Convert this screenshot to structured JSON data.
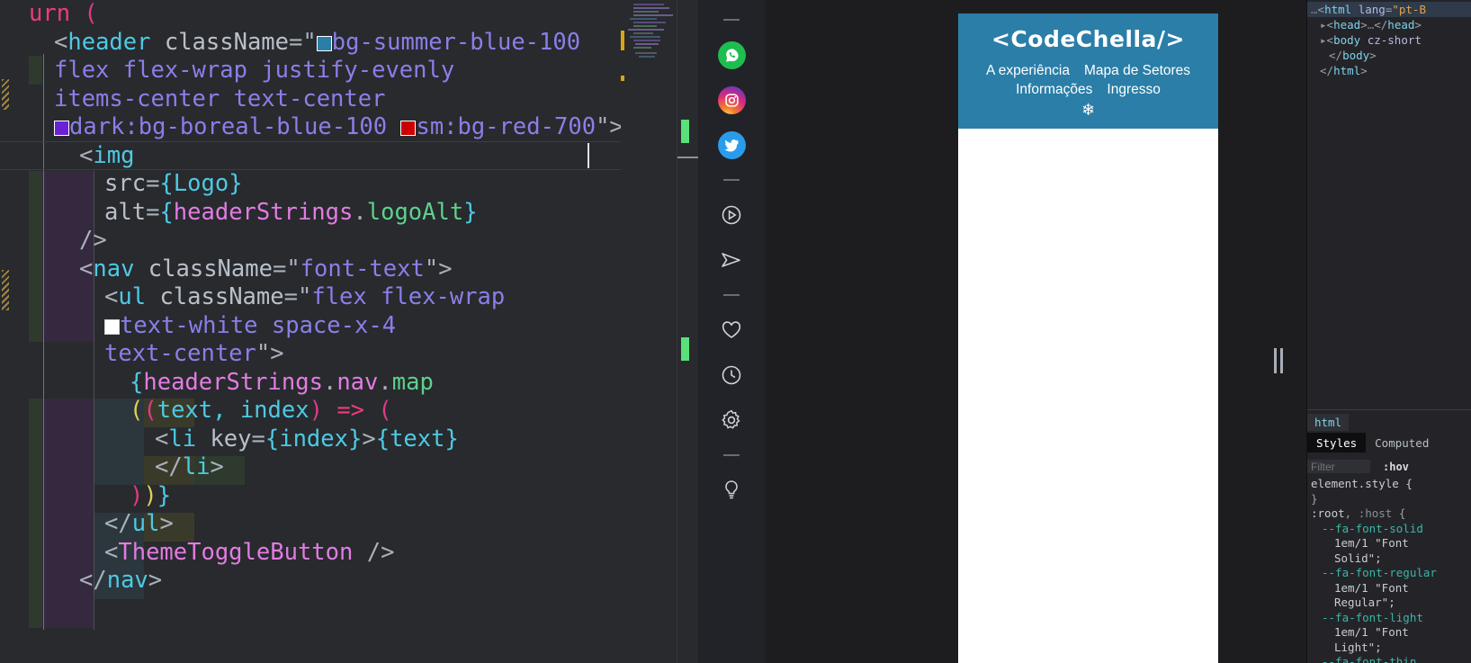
{
  "editor": {
    "language": "jsx",
    "code_lines": [
      {
        "indent": 0,
        "segments": [
          {
            "t": "urn ",
            "c": "tok-kw"
          },
          {
            "t": "(",
            "c": "tok-paren-p"
          }
        ]
      },
      {
        "indent": 1,
        "segments": [
          {
            "t": "<",
            "c": "tok-punc"
          },
          {
            "t": "header",
            "c": "tok-tag"
          },
          {
            "t": " ",
            "c": "tok-attr"
          },
          {
            "t": "className",
            "c": "tok-attr"
          },
          {
            "t": "=",
            "c": "tok-punc"
          },
          {
            "t": "\"",
            "c": "tok-strq"
          },
          {
            "t": "swatch-blue",
            "c": "swatch"
          },
          {
            "t": "bg-summer-blue-100",
            "c": "tok-str"
          }
        ]
      },
      {
        "indent": 1,
        "segments": [
          {
            "t": "flex flex-wrap justify-evenly",
            "c": "tok-str"
          }
        ]
      },
      {
        "indent": 1,
        "segments": [
          {
            "t": "items-center text-center",
            "c": "tok-str"
          }
        ]
      },
      {
        "indent": 1,
        "segments": [
          {
            "t": "swatch-purple",
            "c": "swatch"
          },
          {
            "t": "dark:bg-boreal-blue-100 ",
            "c": "tok-str"
          },
          {
            "t": "swatch-red",
            "c": "swatch"
          },
          {
            "t": "sm:bg-red-700",
            "c": "tok-str"
          },
          {
            "t": "\"",
            "c": "tok-strq"
          },
          {
            "t": ">",
            "c": "tok-punc"
          }
        ]
      },
      {
        "indent": 2,
        "segments": [
          {
            "t": "<",
            "c": "tok-punc"
          },
          {
            "t": "img",
            "c": "tok-tag"
          }
        ]
      },
      {
        "indent": 3,
        "segments": [
          {
            "t": "src",
            "c": "tok-attr"
          },
          {
            "t": "=",
            "c": "tok-punc"
          },
          {
            "t": "{",
            "c": "tok-brace"
          },
          {
            "t": "Logo",
            "c": "tok-fn"
          },
          {
            "t": "}",
            "c": "tok-brace"
          }
        ]
      },
      {
        "indent": 3,
        "segments": [
          {
            "t": "alt",
            "c": "tok-attr"
          },
          {
            "t": "=",
            "c": "tok-punc"
          },
          {
            "t": "{",
            "c": "tok-brace"
          },
          {
            "t": "headerStrings",
            "c": "tok-var"
          },
          {
            "t": ".",
            "c": "tok-punc"
          },
          {
            "t": "logoAlt",
            "c": "tok-prop"
          },
          {
            "t": "}",
            "c": "tok-brace"
          }
        ]
      },
      {
        "indent": 2,
        "segments": [
          {
            "t": "/>",
            "c": "tok-punc"
          }
        ]
      },
      {
        "indent": 2,
        "segments": [
          {
            "t": "<",
            "c": "tok-punc"
          },
          {
            "t": "nav",
            "c": "tok-tag"
          },
          {
            "t": " ",
            "c": "tok-attr"
          },
          {
            "t": "className",
            "c": "tok-attr"
          },
          {
            "t": "=",
            "c": "tok-punc"
          },
          {
            "t": "\"",
            "c": "tok-strq"
          },
          {
            "t": "font-text",
            "c": "tok-str"
          },
          {
            "t": "\"",
            "c": "tok-strq"
          },
          {
            "t": ">",
            "c": "tok-punc"
          }
        ]
      },
      {
        "indent": 3,
        "segments": [
          {
            "t": "<",
            "c": "tok-punc"
          },
          {
            "t": "ul",
            "c": "tok-tag"
          },
          {
            "t": " ",
            "c": "tok-attr"
          },
          {
            "t": "className",
            "c": "tok-attr"
          },
          {
            "t": "=",
            "c": "tok-punc"
          },
          {
            "t": "\"",
            "c": "tok-strq"
          },
          {
            "t": "flex flex-wrap",
            "c": "tok-str"
          }
        ]
      },
      {
        "indent": 3,
        "segments": [
          {
            "t": "swatch-white",
            "c": "swatch"
          },
          {
            "t": "text-white space-x-4",
            "c": "tok-str"
          }
        ]
      },
      {
        "indent": 3,
        "segments": [
          {
            "t": "text-center",
            "c": "tok-str"
          },
          {
            "t": "\"",
            "c": "tok-strq"
          },
          {
            "t": ">",
            "c": "tok-punc"
          }
        ]
      },
      {
        "indent": 4,
        "segments": [
          {
            "t": "{",
            "c": "tok-brace"
          },
          {
            "t": "headerStrings",
            "c": "tok-var"
          },
          {
            "t": ".",
            "c": "tok-punc"
          },
          {
            "t": "nav",
            "c": "tok-var"
          },
          {
            "t": ".",
            "c": "tok-punc"
          },
          {
            "t": "map",
            "c": "tok-prop"
          }
        ]
      },
      {
        "indent": 4,
        "segments": [
          {
            "t": "(",
            "c": "tok-paren-y"
          },
          {
            "t": "(",
            "c": "tok-paren-p"
          },
          {
            "t": "text, index",
            "c": "tok-fn"
          },
          {
            "t": ")",
            "c": "tok-paren-p"
          },
          {
            "t": " => ",
            "c": "tok-kw"
          },
          {
            "t": "(",
            "c": "tok-paren-p"
          }
        ]
      },
      {
        "indent": 5,
        "segments": [
          {
            "t": "<",
            "c": "tok-punc"
          },
          {
            "t": "li",
            "c": "tok-tag"
          },
          {
            "t": " ",
            "c": "tok-attr"
          },
          {
            "t": "key",
            "c": "tok-attr"
          },
          {
            "t": "=",
            "c": "tok-punc"
          },
          {
            "t": "{",
            "c": "tok-brace"
          },
          {
            "t": "index",
            "c": "tok-fn"
          },
          {
            "t": "}",
            "c": "tok-brace"
          },
          {
            "t": ">",
            "c": "tok-punc"
          },
          {
            "t": "{",
            "c": "tok-brace"
          },
          {
            "t": "text",
            "c": "tok-fn"
          },
          {
            "t": "}",
            "c": "tok-brace"
          }
        ]
      },
      {
        "indent": 5,
        "segments": [
          {
            "t": "</",
            "c": "tok-punc"
          },
          {
            "t": "li",
            "c": "tok-tag"
          },
          {
            "t": ">",
            "c": "tok-punc"
          }
        ]
      },
      {
        "indent": 4,
        "segments": [
          {
            "t": ")",
            "c": "tok-paren-p"
          },
          {
            "t": ")",
            "c": "tok-paren-y"
          },
          {
            "t": "}",
            "c": "tok-brace"
          }
        ]
      },
      {
        "indent": 3,
        "segments": [
          {
            "t": "</",
            "c": "tok-punc"
          },
          {
            "t": "ul",
            "c": "tok-tag"
          },
          {
            "t": ">",
            "c": "tok-punc"
          }
        ]
      },
      {
        "indent": 3,
        "segments": [
          {
            "t": "<",
            "c": "tok-punc"
          },
          {
            "t": "ThemeToggleButton",
            "c": "tok-comp"
          },
          {
            "t": " />",
            "c": "tok-punc"
          }
        ]
      },
      {
        "indent": 2,
        "segments": [
          {
            "t": "</",
            "c": "tok-punc"
          },
          {
            "t": "nav",
            "c": "tok-tag"
          },
          {
            "t": ">",
            "c": "tok-punc"
          }
        ]
      }
    ],
    "minimap_visible": true,
    "overview_marks": 2,
    "colors": {
      "background": "#282a2e",
      "swatch_summer_blue": "#2a7ea8",
      "swatch_boreal_blue": "#6b21d6",
      "swatch_red_700": "#cc0000",
      "swatch_white": "#ffffff",
      "ruler_mark": "#5ae07a"
    }
  },
  "rail": {
    "items": [
      {
        "name": "divider",
        "icon": "divider-line",
        "label": ""
      },
      {
        "name": "whatsapp",
        "icon": "whatsapp-icon",
        "label": "WhatsApp"
      },
      {
        "name": "instagram",
        "icon": "instagram-icon",
        "label": "Instagram"
      },
      {
        "name": "twitter",
        "icon": "twitter-icon",
        "label": "Twitter"
      },
      {
        "name": "divider",
        "icon": "divider-line",
        "label": ""
      },
      {
        "name": "video",
        "icon": "play-circle-icon",
        "label": "Play"
      },
      {
        "name": "send",
        "icon": "send-icon",
        "label": "Send"
      },
      {
        "name": "divider",
        "icon": "divider-line",
        "label": ""
      },
      {
        "name": "favorites",
        "icon": "heart-icon",
        "label": "Favorites"
      },
      {
        "name": "history",
        "icon": "clock-icon",
        "label": "History"
      },
      {
        "name": "settings",
        "icon": "gear-icon",
        "label": "Settings"
      },
      {
        "name": "divider",
        "icon": "divider-line",
        "label": ""
      },
      {
        "name": "ideas",
        "icon": "lightbulb-icon",
        "label": "Ideas"
      }
    ]
  },
  "preview": {
    "logo": "<CodeChella/>",
    "nav": [
      "A experiência",
      "Mapa de Setores",
      "Informações",
      "Ingresso"
    ],
    "theme_toggle_glyph": "❄",
    "header_bg": "#2a7ea8",
    "resizer_name": "panel-resize-handle"
  },
  "devtools": {
    "dom_lines": [
      {
        "indent": 0,
        "selected": true,
        "segments": [
          {
            "t": "…",
            "c": "d-grey"
          },
          {
            "t": "<",
            "c": "d-punc"
          },
          {
            "t": "html",
            "c": "d-tag"
          },
          {
            "t": " ",
            "c": "d-punc"
          },
          {
            "t": "lang",
            "c": "d-attr"
          },
          {
            "t": "=",
            "c": "d-punc"
          },
          {
            "t": "\"pt-B",
            "c": "d-val"
          }
        ]
      },
      {
        "indent": 1,
        "arrow": true,
        "segments": [
          {
            "t": "<",
            "c": "d-punc"
          },
          {
            "t": "head",
            "c": "d-tag"
          },
          {
            "t": ">",
            "c": "d-punc"
          },
          {
            "t": "…",
            "c": "d-grey"
          },
          {
            "t": "</",
            "c": "d-punc"
          },
          {
            "t": "head",
            "c": "d-tag"
          },
          {
            "t": ">",
            "c": "d-punc"
          }
        ]
      },
      {
        "indent": 1,
        "arrow": true,
        "segments": [
          {
            "t": "<",
            "c": "d-punc"
          },
          {
            "t": "body",
            "c": "d-tag"
          },
          {
            "t": " ",
            "c": "d-punc"
          },
          {
            "t": "cz-short",
            "c": "d-attr"
          }
        ]
      },
      {
        "indent": 2,
        "segments": [
          {
            "t": "</",
            "c": "d-punc"
          },
          {
            "t": "body",
            "c": "d-tag"
          },
          {
            "t": ">",
            "c": "d-punc"
          }
        ]
      },
      {
        "indent": 1,
        "segments": [
          {
            "t": "</",
            "c": "d-punc"
          },
          {
            "t": "html",
            "c": "d-tag"
          },
          {
            "t": ">",
            "c": "d-punc"
          }
        ]
      }
    ],
    "breadcrumb": "html",
    "tabs": [
      {
        "label": "Styles",
        "active": true
      },
      {
        "label": "Computed",
        "active": false
      }
    ],
    "filter_placeholder": "Filter",
    "hov_label": ":hov",
    "css_lines": [
      {
        "ind": 0,
        "segments": [
          {
            "t": "element.style {",
            "c": "c-sel"
          }
        ]
      },
      {
        "ind": 0,
        "segments": [
          {
            "t": "}",
            "c": "c-punc"
          }
        ]
      },
      {
        "ind": 0,
        "segments": [
          {
            "t": ":root",
            "c": "c-sel"
          },
          {
            "t": ", ",
            "c": "c-punc"
          },
          {
            "t": ":host",
            "c": "c-pseudo"
          },
          {
            "t": " {",
            "c": "c-punc"
          }
        ]
      },
      {
        "ind": 1,
        "segments": [
          {
            "t": "--fa-font-solid",
            "c": "c-prop"
          }
        ]
      },
      {
        "ind": 2,
        "segments": [
          {
            "t": "1em/1 \"Font",
            "c": "c-val"
          }
        ]
      },
      {
        "ind": 2,
        "segments": [
          {
            "t": "Solid\";",
            "c": "c-val"
          }
        ]
      },
      {
        "ind": 1,
        "segments": [
          {
            "t": "--fa-font-regular",
            "c": "c-prop"
          }
        ]
      },
      {
        "ind": 2,
        "segments": [
          {
            "t": "1em/1 \"Font",
            "c": "c-val"
          }
        ]
      },
      {
        "ind": 2,
        "segments": [
          {
            "t": "Regular\";",
            "c": "c-val"
          }
        ]
      },
      {
        "ind": 1,
        "segments": [
          {
            "t": "--fa-font-light",
            "c": "c-prop"
          }
        ]
      },
      {
        "ind": 2,
        "segments": [
          {
            "t": "1em/1 \"Font",
            "c": "c-val"
          }
        ]
      },
      {
        "ind": 2,
        "segments": [
          {
            "t": "Light\";",
            "c": "c-val"
          }
        ]
      },
      {
        "ind": 1,
        "segments": [
          {
            "t": "--fa-font-thin",
            "c": "c-prop"
          }
        ]
      }
    ]
  }
}
